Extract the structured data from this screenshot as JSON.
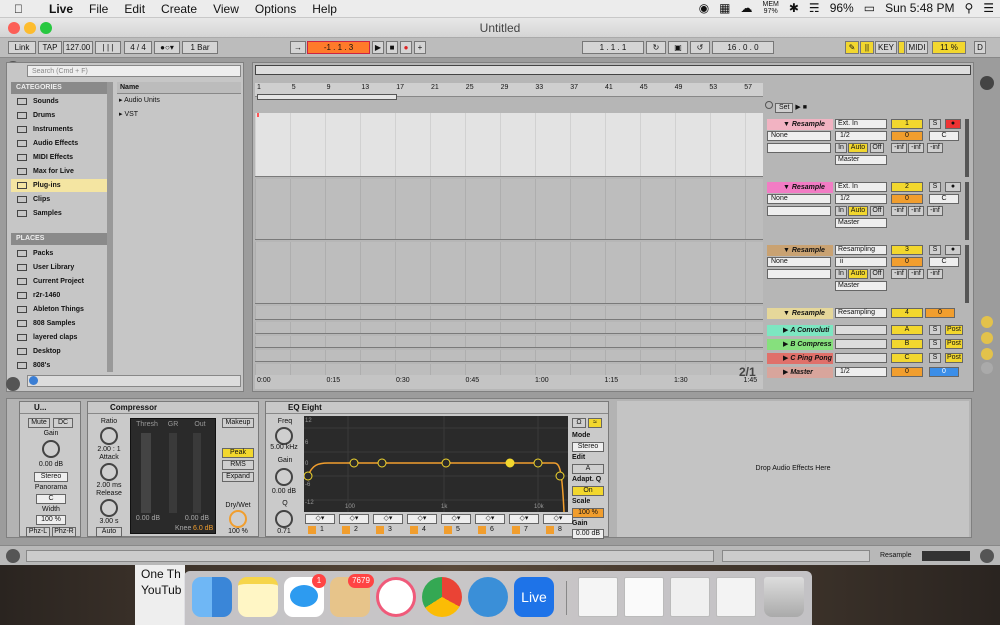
{
  "menubar": {
    "app": "Live",
    "items": [
      "File",
      "Edit",
      "Create",
      "View",
      "Options",
      "Help"
    ],
    "mem_label": "MEM",
    "mem_value": "97%",
    "battery": "96%",
    "clock": "Sun 5:48 PM"
  },
  "window": {
    "title": "Untitled"
  },
  "transport": {
    "link": "Link",
    "tap": "TAP",
    "tempo": "127.00",
    "sig": "4 / 4",
    "quant": "1 Bar",
    "position": "-1 . 1 . 3",
    "loop_start": "1 . 1 . 1",
    "loop_len": "16 . 0 . 0",
    "key": "KEY",
    "midi": "MIDI",
    "cpu": "11 %",
    "d": "D"
  },
  "browser": {
    "search_placeholder": "Search (Cmd + F)",
    "categories_title": "CATEGORIES",
    "categories": [
      "Sounds",
      "Drums",
      "Instruments",
      "Audio Effects",
      "MIDI Effects",
      "Max for Live",
      "Plug-ins",
      "Clips",
      "Samples"
    ],
    "places_title": "PLACES",
    "places": [
      "Packs",
      "User Library",
      "Current Project",
      "r2r-1460",
      "Ableton Things",
      "808 Samples",
      "layered claps",
      "Desktop",
      "808's"
    ],
    "name_header": "Name",
    "items": [
      "Audio Units",
      "VST"
    ]
  },
  "arrangement": {
    "bars": [
      "1",
      "5",
      "9",
      "13",
      "17",
      "21",
      "25",
      "29",
      "33",
      "37",
      "41",
      "45",
      "49",
      "53",
      "57"
    ],
    "times": [
      "0:00",
      "0:15",
      "0:30",
      "0:45",
      "1:00",
      "1:15",
      "1:30",
      "1:45"
    ],
    "page": "2/1",
    "set_label": "Set",
    "tracks": [
      {
        "name": "Resample",
        "color": "#f2b3c2",
        "input": "Ext. In",
        "sub": "1/2",
        "num": "1",
        "gain": "0",
        "pan": "C",
        "out": "Master",
        "sel": "None"
      },
      {
        "name": "Resample",
        "color": "#f27cc4",
        "input": "Ext. In",
        "sub": "1/2",
        "num": "2",
        "gain": "0",
        "pan": "C",
        "out": "Master",
        "sel": "None"
      },
      {
        "name": "Resample",
        "color": "#c9a272",
        "input": "Resampling",
        "sub": "ii",
        "num": "3",
        "gain": "0",
        "pan": "C",
        "out": "Master",
        "sel": "None"
      },
      {
        "name": "Resample",
        "color": "#e5d79a",
        "input": "Resampling",
        "num": "4",
        "gain": "0"
      }
    ],
    "returns": [
      {
        "name": "A Convoluti",
        "color": "#7de6c1",
        "num": "A"
      },
      {
        "name": "B Compress",
        "color": "#86e07d",
        "num": "B"
      },
      {
        "name": "C Ping Pong",
        "color": "#e0706a",
        "num": "C"
      }
    ],
    "master": {
      "name": "Master",
      "color": "#d8a59c",
      "sub": "1/2",
      "num": "0",
      "out": "0"
    },
    "in": "In",
    "auto": "Auto",
    "off": "Off",
    "inf": "-inf",
    "s": "S",
    "post": "Post"
  },
  "utility": {
    "title": "U...",
    "mute": "Mute",
    "dc": "DC",
    "gain_label": "Gain",
    "gain": "0.00 dB",
    "stereo": "Stereo",
    "pan_label": "Panorama",
    "pan": "C",
    "width_label": "Width",
    "width": "100 %",
    "phzl": "Phz-L",
    "phzr": "Phz-R"
  },
  "compressor": {
    "title": "Compressor",
    "ratio_label": "Ratio",
    "ratio": "2.00 : 1",
    "attack_label": "Attack",
    "attack": "2.00 ms",
    "release_label": "Release",
    "release": "3.00 s",
    "auto": "Auto",
    "thresh": "Thresh",
    "gr": "GR",
    "out": "Out",
    "thresh_val": "0.00 dB",
    "out_val": "0.00 dB",
    "knee_label": "Knee",
    "knee": "6.0 dB",
    "makeup": "Makeup",
    "peak": "Peak",
    "rms": "RMS",
    "expand": "Expand",
    "drywet_label": "Dry/Wet",
    "drywet": "100 %"
  },
  "eq": {
    "title": "EQ Eight",
    "freq_label": "Freq",
    "freq": "5.00 kHz",
    "gain_label": "Gain",
    "gain": "0.00 dB",
    "q_label": "Q",
    "q": "0.71",
    "db_ticks": [
      "12",
      "6",
      "0",
      "-6",
      "-12"
    ],
    "freq_ticks": [
      "100",
      "1k",
      "10k"
    ],
    "mode_label": "Mode",
    "mode": "Stereo",
    "edit_label": "Edit",
    "adapt_label": "Adapt. Q",
    "adapt": "On",
    "scale_label": "Scale",
    "scale": "100 %",
    "outgain_label": "Gain",
    "outgain": "0.00 dB",
    "bands": [
      "1",
      "2",
      "3",
      "4",
      "5",
      "6",
      "7",
      "8"
    ]
  },
  "drop_text": "Drop Audio Effects Here",
  "statusbar": {
    "track": "Resample"
  },
  "dock": {
    "badge1": "1",
    "badge2": "7679",
    "live": "Live"
  },
  "video_bg": {
    "line1": "One Th",
    "line2": "YouTub"
  },
  "colors": {
    "accent": "#f2d72e",
    "orange": "#f19e2e",
    "eq_curve": "#f19e2e"
  }
}
